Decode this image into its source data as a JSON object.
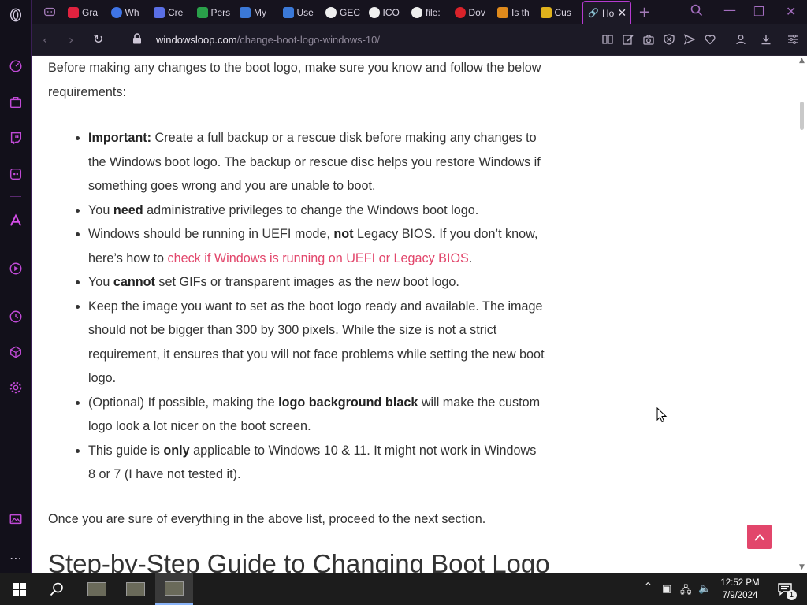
{
  "tabs": [
    {
      "label": "Gra",
      "icon": "gx-icon",
      "color": "#e0223f"
    },
    {
      "label": "Wh",
      "icon": "whale-icon",
      "color": "#3f74e6"
    },
    {
      "label": "Cre",
      "icon": "hexagon-icon",
      "color": "#5a6fe6"
    },
    {
      "label": "Pers",
      "icon": "windows-logo-icon",
      "color": "#2aa04a"
    },
    {
      "label": "My",
      "icon": "a-badge-icon",
      "color": "#3b79d8"
    },
    {
      "label": "Use",
      "icon": "a-badge-icon",
      "color": "#3b79d8"
    },
    {
      "label": "GEC",
      "icon": "globe-icon",
      "color": "#dddddd"
    },
    {
      "label": "ICO",
      "icon": "globe-icon",
      "color": "#dddddd"
    },
    {
      "label": "file:",
      "icon": "globe-icon",
      "color": "#dddddd"
    },
    {
      "label": "Dov",
      "icon": "opera-red-icon",
      "color": "#d9222a"
    },
    {
      "label": "Is th",
      "icon": "ten-forums-icon",
      "color": "#e08a1c"
    },
    {
      "label": "Cus",
      "icon": "colorful-square-icon",
      "color": "#e0b21c"
    }
  ],
  "active_tab": {
    "label": "Ho",
    "icon": "link-icon"
  },
  "address": {
    "domain": "windowsloop.com",
    "path": "/change-boot-logo-windows-10/"
  },
  "article": {
    "intro": "Before making any changes to the boot logo, make sure you know and follow the below requirements:",
    "items": [
      {
        "b1": "Important:",
        "t1": " Create a full backup or a rescue disk before making any changes to the Windows boot logo. The backup or rescue disc helps you restore Windows if something goes wrong and you are unable to boot."
      },
      {
        "t0": "You ",
        "b1": "need",
        "t1": " administrative privileges to change the Windows boot logo."
      },
      {
        "t0": "Windows should be running in UEFI mode, ",
        "b1": "not",
        "t1": " Legacy BIOS. If you don’t know, here’s how to ",
        "link": "check if Windows is running on UEFI or Legacy BIOS",
        "t2": "."
      },
      {
        "t0": "You ",
        "b1": "cannot",
        "t1": " set GIFs or transparent images as the new boot logo."
      },
      {
        "t0": "Keep the image you want to set as the boot logo ready and available. The image should not be bigger than 300 by 300 pixels. While the size is not a strict requirement, it ensures that you will not face problems while setting the new boot logo."
      },
      {
        "t0": "(Optional) If possible, making the ",
        "b1": "logo background black",
        "t1": " will make the custom logo look a lot nicer on the boot screen."
      },
      {
        "t0": "This guide is ",
        "b1": "only",
        "t1": " applicable to Windows 10 & 11. It might not work in Windows 8 or 7 (I have not tested it)."
      }
    ],
    "outro": "Once you are sure of everything in the above list, proceed to the next section.",
    "heading": "Step-by-Step Guide to Changing Boot Logo"
  },
  "taskbar": {
    "time": "12:52 PM",
    "date": "7/9/2024",
    "notification_count": "1"
  },
  "colors": {
    "accent": "#b53ad0",
    "link": "#e2466b"
  }
}
